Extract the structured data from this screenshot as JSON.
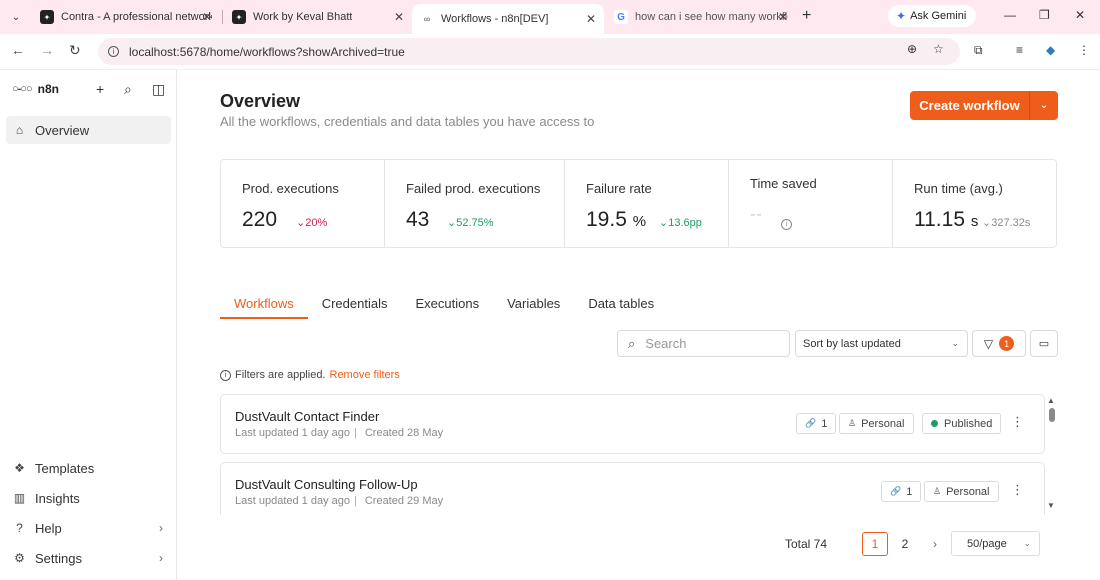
{
  "browser": {
    "tabs": [
      {
        "title": "Contra - A professional network",
        "active": false
      },
      {
        "title": "Work by Keval Bhatt",
        "active": false
      },
      {
        "title": "Workflows - n8n[DEV]",
        "active": true
      },
      {
        "title": "how can i see how many workflo",
        "active": false
      }
    ],
    "gemini_label": "Ask Gemini",
    "url": "localhost:5678/home/workflows?showArchived=true"
  },
  "sidebar": {
    "brand": "n8n",
    "top_items": [
      {
        "label": "Overview",
        "icon": "home-icon",
        "active": true
      }
    ],
    "bottom_items": [
      {
        "label": "Templates",
        "icon": "templates-icon"
      },
      {
        "label": "Insights",
        "icon": "insights-icon"
      },
      {
        "label": "Help",
        "icon": "help-icon"
      },
      {
        "label": "Settings",
        "icon": "settings-icon"
      }
    ]
  },
  "header": {
    "title": "Overview",
    "subtitle": "All the workflows, credentials and data tables you have access to",
    "create_label": "Create workflow"
  },
  "stats": [
    {
      "label": "Prod. executions",
      "value": "220",
      "unit": "",
      "delta": "20%",
      "trend": "down",
      "tone": "bad"
    },
    {
      "label": "Failed prod. executions",
      "value": "43",
      "unit": "",
      "delta": "52.75%",
      "trend": "down",
      "tone": "good"
    },
    {
      "label": "Failure rate",
      "value": "19.5",
      "unit": "%",
      "delta": "13.6pp",
      "trend": "down",
      "tone": "good"
    },
    {
      "label": "Time saved",
      "value": "--",
      "unit": "",
      "delta": "",
      "trend": "",
      "tone": "neutral"
    },
    {
      "label": "Run time (avg.)",
      "value": "11.15",
      "unit": "s",
      "delta": "327.32s",
      "trend": "down",
      "tone": "neutral"
    }
  ],
  "tabs": [
    "Workflows",
    "Credentials",
    "Executions",
    "Variables",
    "Data tables"
  ],
  "active_tab": "Workflows",
  "controls": {
    "search_placeholder": "Search",
    "sort_value": "Sort by last updated",
    "filter_count": "1"
  },
  "filters_note": {
    "text": "Filters are applied.",
    "action": "Remove filters"
  },
  "workflows": [
    {
      "name": "DustVault Contact Finder",
      "updated": "Last updated 1 day ago",
      "created": "Created 28 May",
      "links": "1",
      "owner": "Personal",
      "status": "Published"
    },
    {
      "name": "DustVault Consulting Follow-Up",
      "updated": "Last updated 1 day ago",
      "created": "Created 29 May",
      "links": "1",
      "owner": "Personal",
      "status": ""
    }
  ],
  "pagination": {
    "total": "Total 74",
    "pages": [
      "1",
      "2"
    ],
    "current": "1",
    "per_page": "50/page"
  },
  "colors": {
    "accent": "#ee5e1a",
    "bad": "#d2204b",
    "good": "#19a060",
    "chrome_bg": "#fde9ef"
  }
}
